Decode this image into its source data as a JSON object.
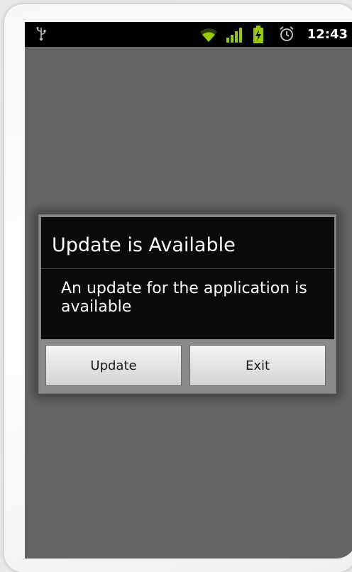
{
  "status_bar": {
    "time": "12:43",
    "icons": [
      "usb-icon",
      "wifi-icon",
      "signal-icon",
      "battery-charging-icon",
      "alarm-icon"
    ],
    "accent_color": "#99cc00"
  },
  "dialog": {
    "title": "Update is Available",
    "message": "An update for the application is available",
    "buttons": {
      "update_label": "Update",
      "exit_label": "Exit"
    }
  }
}
